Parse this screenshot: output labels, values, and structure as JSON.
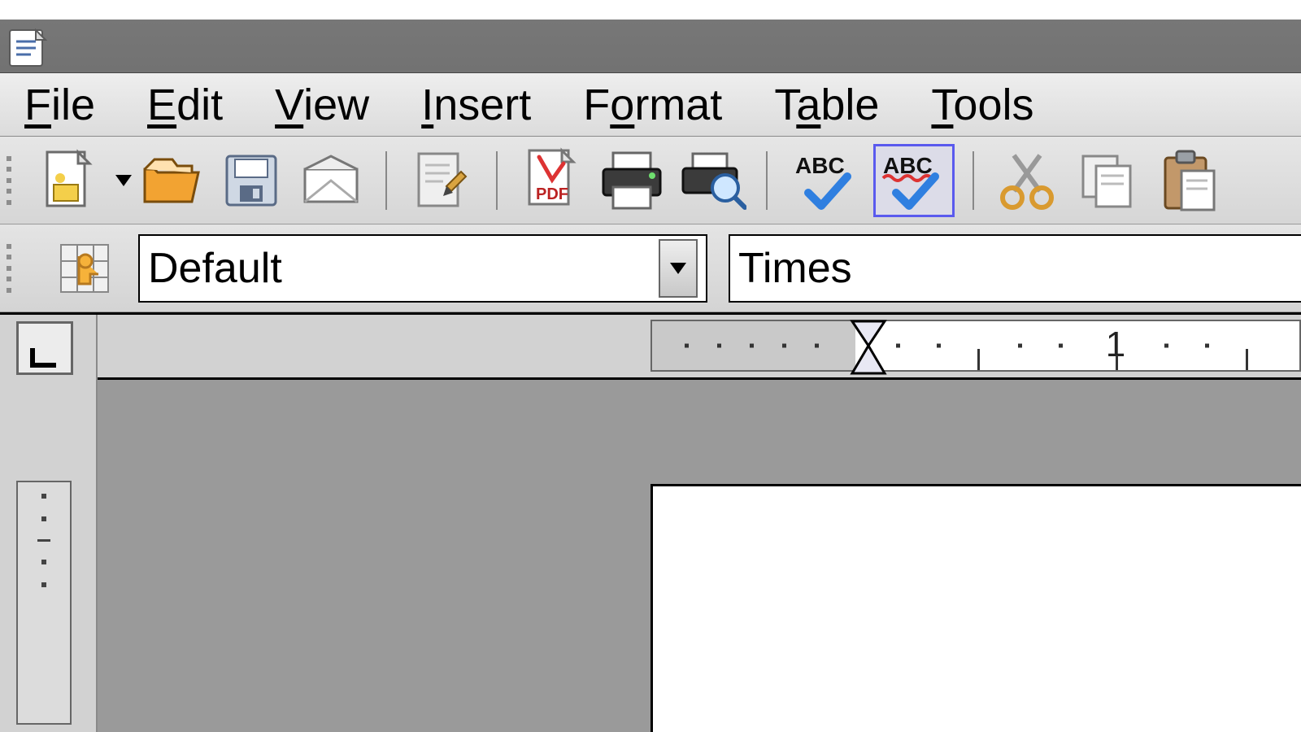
{
  "menubar": {
    "file": {
      "hot": "F",
      "rest": "ile"
    },
    "edit": {
      "hot": "E",
      "rest": "dit"
    },
    "view": {
      "hot": "V",
      "rest": "iew"
    },
    "insert": {
      "hot": "I",
      "rest": "nsert"
    },
    "format": {
      "pre": "F",
      "hot": "o",
      "rest": "rmat"
    },
    "table": {
      "pre": "T",
      "hot": "a",
      "rest": "ble"
    },
    "tools": {
      "hot": "T",
      "rest": "ools"
    }
  },
  "toolbar": {
    "spellcheck_label": "ABC",
    "autospell_label": "ABC",
    "pdf_label": "PDF"
  },
  "formatting": {
    "style_value": "Default",
    "font_value": "Times"
  },
  "ruler": {
    "marks": [
      "1"
    ]
  }
}
